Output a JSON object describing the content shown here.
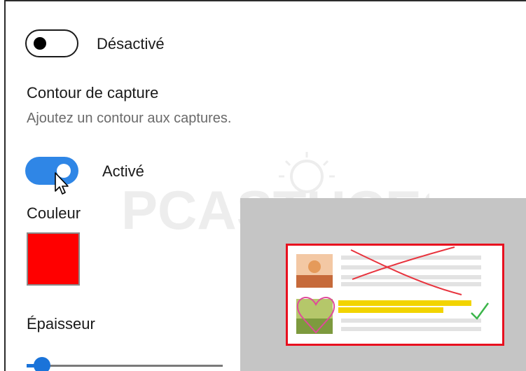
{
  "border_toggle_prev": {
    "state_label": "Désactivé",
    "on": false
  },
  "capture_outline": {
    "title": "Contour de capture",
    "description": "Ajoutez un contour aux captures.",
    "state_label": "Activé",
    "on": true
  },
  "color": {
    "label": "Couleur",
    "value": "#ff0000"
  },
  "thickness": {
    "label": "Épaisseur",
    "level": 0.08
  },
  "watermark": {
    "text": "PCASTUCES"
  },
  "colors": {
    "accent": "#2f86e6",
    "outline": "#e8101f",
    "preview_bg": "#c5c5c5",
    "check": "#3bb54a",
    "highlight": "#f2d400"
  }
}
